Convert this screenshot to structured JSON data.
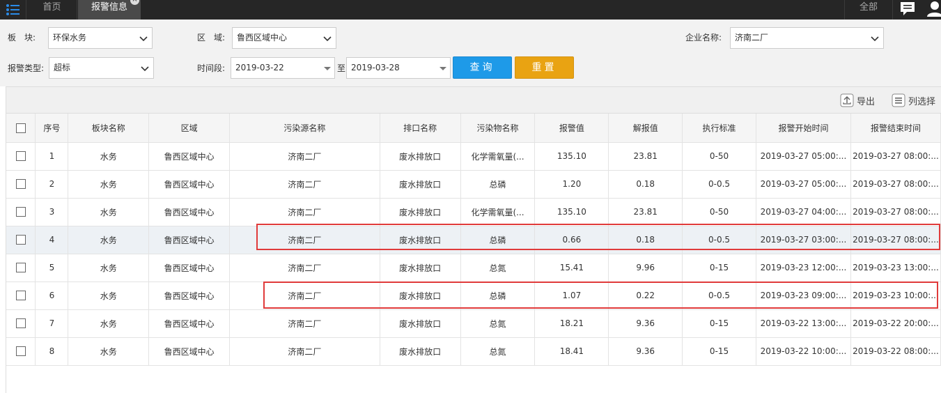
{
  "topbar": {
    "home_tab": "首页",
    "alarm_tab": "报警信息",
    "close_glyph": "×",
    "all_label": "全部"
  },
  "filters": {
    "sector_label": "板　块:",
    "sector_value": "环保水务",
    "region_label": "区　域:",
    "region_value": "鲁西区域中心",
    "company_label": "企业名称:",
    "company_value": "济南二厂",
    "type_label": "报警类型:",
    "type_value": "超标",
    "period_label": "时间段:",
    "date_from": "2019-03-22",
    "date_sep": "至",
    "date_to": "2019-03-28",
    "query_button": "查询",
    "reset_button": "重置"
  },
  "toolbar": {
    "export_label": "导出",
    "columns_label": "列选择"
  },
  "table": {
    "headers": [
      "序号",
      "板块名称",
      "区域",
      "污染源名称",
      "排口名称",
      "污染物名称",
      "报警值",
      "解报值",
      "执行标准",
      "报警开始时间",
      "报警结束时间"
    ],
    "rows": [
      [
        "1",
        "水务",
        "鲁西区域中心",
        "济南二厂",
        "废水排放口",
        "化学需氧量(...",
        "135.10",
        "23.81",
        "0-50",
        "2019-03-27 05:00:...",
        "2019-03-27 08:00:..."
      ],
      [
        "2",
        "水务",
        "鲁西区域中心",
        "济南二厂",
        "废水排放口",
        "总磷",
        "1.20",
        "0.18",
        "0-0.5",
        "2019-03-27 05:00:...",
        "2019-03-27 08:00:..."
      ],
      [
        "3",
        "水务",
        "鲁西区域中心",
        "济南二厂",
        "废水排放口",
        "化学需氧量(...",
        "135.10",
        "23.81",
        "0-50",
        "2019-03-27 04:00:...",
        "2019-03-27 08:00:..."
      ],
      [
        "4",
        "水务",
        "鲁西区域中心",
        "济南二厂",
        "废水排放口",
        "总磷",
        "0.66",
        "0.18",
        "0-0.5",
        "2019-03-27 03:00:...",
        "2019-03-27 08:00:..."
      ],
      [
        "5",
        "水务",
        "鲁西区域中心",
        "济南二厂",
        "废水排放口",
        "总氮",
        "15.41",
        "9.96",
        "0-15",
        "2019-03-23 12:00:...",
        "2019-03-23 13:00:..."
      ],
      [
        "6",
        "水务",
        "鲁西区域中心",
        "济南二厂",
        "废水排放口",
        "总磷",
        "1.07",
        "0.22",
        "0-0.5",
        "2019-03-23 09:00:...",
        "2019-03-23 10:00:..."
      ],
      [
        "7",
        "水务",
        "鲁西区域中心",
        "济南二厂",
        "废水排放口",
        "总氮",
        "18.21",
        "9.36",
        "0-15",
        "2019-03-22 13:00:...",
        "2019-03-22 20:00:..."
      ],
      [
        "8",
        "水务",
        "鲁西区域中心",
        "济南二厂",
        "废水排放口",
        "总氮",
        "18.41",
        "9.36",
        "0-15",
        "2019-03-22 10:00:...",
        "2019-03-22 08:00:..."
      ]
    ],
    "highlighted_row": 4
  },
  "colors": {
    "query_button": "#1e9ae8",
    "reset_button": "#e9a312",
    "annotation_box": "#e03a3a",
    "topbar": "#262626"
  }
}
